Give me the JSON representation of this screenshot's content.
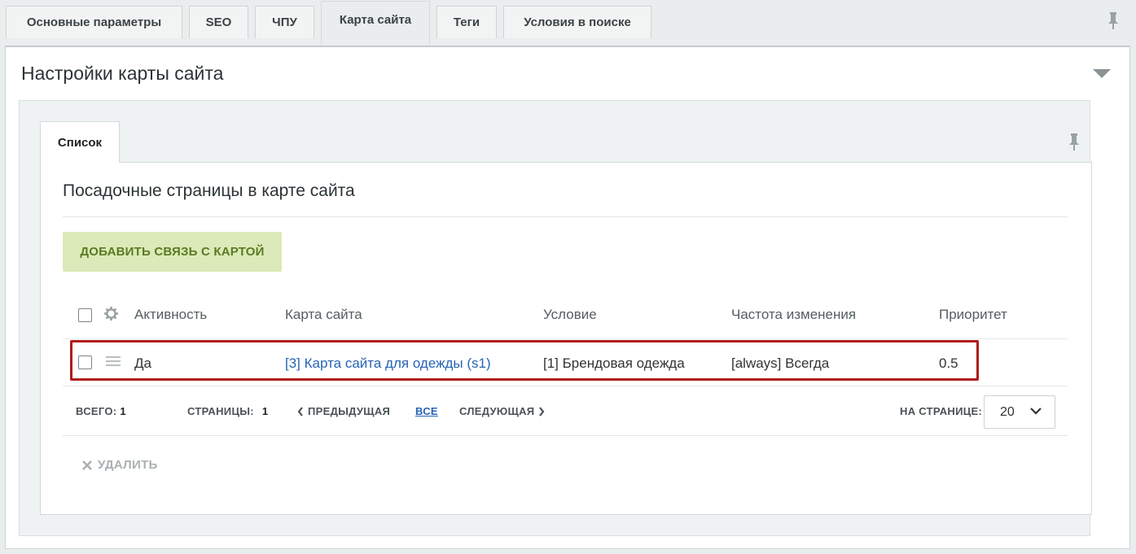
{
  "top_tabs": [
    {
      "label": "Основные параметры",
      "active": false
    },
    {
      "label": "SEO",
      "active": false
    },
    {
      "label": "ЧПУ",
      "active": false
    },
    {
      "label": "Карта сайта",
      "active": true
    },
    {
      "label": "Теги",
      "active": false
    },
    {
      "label": "Условия в поиске",
      "active": false
    }
  ],
  "panel": {
    "title": "Настройки карты сайта",
    "sub_tab": "Список",
    "section_title": "Посадочные страницы в карте сайта",
    "add_button": "ДОБАВИТЬ СВЯЗЬ С КАРТОЙ"
  },
  "table": {
    "columns": [
      "Активность",
      "Карта сайта",
      "Условие",
      "Частота изменения",
      "Приоритет"
    ],
    "rows": [
      {
        "active": "Да",
        "sitemap": "[3] Карта сайта для одежды (s1)",
        "condition": "[1] Брендовая одежда",
        "frequency": "[always] Всегда",
        "priority": "0.5"
      }
    ]
  },
  "footer": {
    "total_label": "ВСЕГО:",
    "total_value": "1",
    "pages_label": "СТРАНИЦЫ:",
    "pages_value": "1",
    "prev_label": "ПРЕДЫДУЩАЯ",
    "all_label": "ВСЕ",
    "next_label": "СЛЕДУЮЩАЯ",
    "per_page_label": "НА СТРАНИЦЕ:",
    "per_page_value": "20"
  },
  "actions": {
    "delete_label": "УДАЛИТЬ"
  },
  "colors": {
    "link": "#2864b4",
    "highlight": "#b01b1b",
    "add_button_bg": "#dbeab8",
    "add_button_text": "#5a7a24"
  }
}
